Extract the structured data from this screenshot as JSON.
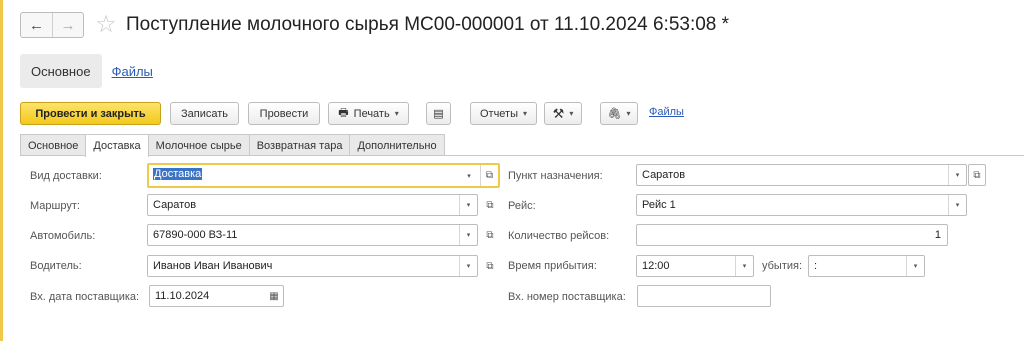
{
  "header": {
    "back_icon": "←",
    "forward_icon": "→",
    "star_icon": "☆",
    "title": "Поступление молочного сырья МС00-000001 от 11.10.2024 6:53:08 *"
  },
  "sections": {
    "active": "Основное",
    "link": "Файлы"
  },
  "toolbar": {
    "post_close": "Провести и закрыть",
    "save": "Записать",
    "post": "Провести",
    "print": "Печать",
    "print_icon": "🖶",
    "doc_icon": "▤",
    "reports": "Отчеты",
    "tools_icon": "⚒",
    "attach_icon": "🖇",
    "files": "Файлы",
    "dropdown_glyph": "▾"
  },
  "tabs": [
    "Основное",
    "Доставка",
    "Молочное сырье",
    "Возвратная тара",
    "Дополнительно"
  ],
  "active_tab": "Доставка",
  "form": {
    "delivery_type": {
      "label": "Вид доставки:",
      "value": "Доставка"
    },
    "route": {
      "label": "Маршрут:",
      "value": "Саратов"
    },
    "vehicle": {
      "label": "Автомобиль:",
      "value": "67890-000 ВЗ-11"
    },
    "driver": {
      "label": "Водитель:",
      "value": "Иванов Иван Иванович"
    },
    "supplier_date": {
      "label": "Вх. дата поставщика:",
      "value": "11.10.2024"
    },
    "destination": {
      "label": "Пункт назначения:",
      "value": "Саратов"
    },
    "trip": {
      "label": "Рейс:",
      "value": "Рейс 1"
    },
    "trips_count": {
      "label": "Количество рейсов:",
      "value": "1"
    },
    "arrival_time": {
      "label": "Время прибытия:",
      "value": "12:00"
    },
    "departure_time": {
      "label": "убытия:",
      "value": " :"
    },
    "supplier_number": {
      "label": "Вх. номер поставщика:",
      "value": ""
    },
    "open_glyph": "⧉",
    "calendar_glyph": "▦"
  }
}
